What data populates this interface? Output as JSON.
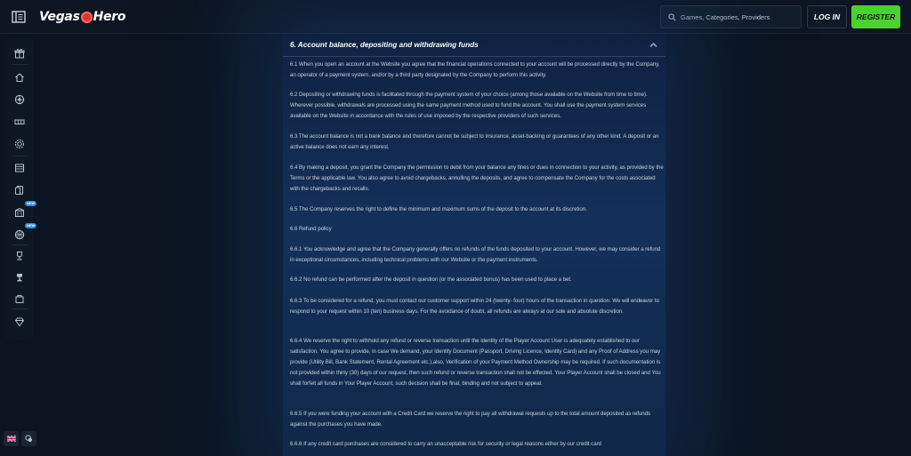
{
  "header": {
    "logo_part1": "Vegas",
    "logo_part2": "Hero",
    "search_placeholder": "Games, Categories, Providers",
    "login_label": "LOG IN",
    "register_label": "REGISTER",
    "colors": {
      "register_bg": "#4cd12f",
      "logo_chip": "#e0322c"
    }
  },
  "sidebar": {
    "items": [
      {
        "icon": "gift-icon"
      },
      {
        "icon": "home-icon"
      },
      {
        "icon": "roulette-icon"
      },
      {
        "icon": "slots-icon"
      },
      {
        "icon": "live-casino-icon"
      },
      {
        "icon": "table-games-icon"
      },
      {
        "icon": "cards-icon"
      },
      {
        "icon": "casino-building-icon",
        "badge": "NEW"
      },
      {
        "icon": "sports-ball-icon",
        "badge": "NEW"
      },
      {
        "icon": "trophy-icon"
      },
      {
        "icon": "tournament-cup-icon"
      },
      {
        "icon": "shop-icon"
      },
      {
        "icon": "diamond-icon"
      }
    ],
    "bottom": {
      "language_icon": "uk-flag-icon",
      "support_icon": "chat-icon"
    }
  },
  "section": {
    "title": "6.    Account balance, depositing and withdrawing funds",
    "paragraphs": [
      "6.1 When you open an account at the Website you agree that the financial operations connected to your account will be processed directly by the Company, an operator of a payment system, and/or by a third party designated by the Company to perform this activity.",
      "6.2 Depositing or withdrawing funds is facilitated through the payment system of your choice (among those available on the Website from time to time). Wherever possible, withdrawals are processed using the same payment method used to fund the account. You shall use the payment system services available on the Website in accordance with the rules of use imposed by the respective providers of such services.",
      "6.3 The account balance is not a bank balance and therefore cannot be subject to insurance, asset-backing or guarantees of any other kind. A deposit or an active balance does not earn any interest.",
      "6.4 By making a deposit, you grant the Company the permission to debit from your balance any fines or dues in connection to your activity, as provided by the Terms or the applicable law. You also agree to avoid chargebacks, annulling the deposits, and agree to compensate the Company for the costs associated with the chargebacks and recalls.",
      "6.5 The Company reserves the right to define the minimum and maximum sums of the deposit to the account at its discretion.",
      "6.6 Refund policy",
      "6.6.1 You acknowledge and agree that the Company generally offers no refunds of the funds deposited to your account. However, we may consider a refund in exceptional circumstances, including technical problems with our Website or the payment instruments.",
      "6.6.2 No refund can be performed after the deposit in question (or the associated bonus) has been used to place a bet.",
      "6.6.3 To be considered for a refund, you must contact our customer support within 24 (twenty- four) hours of the transaction in question. We will endeavor to respond to your request within 10 (ten) business days. For the avoidance of doubt, all refunds are always at our sole and absolute discretion.",
      "6.6.4 We reserve the right to withhold any refund or reverse transaction until the identity of the Player Account User is adequately established to our satisfaction. You agree to provide, in case We demand, your Identity Document (Passport, Driving Licence, Identity Card) and any Proof of Address you may provide (Utility Bill, Bank Statement, Rental Agreement etc.),also, Verification of your Payment Method Ownership may be required. If such documentation is not provided within thirty (30) days of our request, then such refund or reverse transaction shall not be effected. Your Player Account shall be closed and You shall forfeit all funds in Your Player Account, such decision shall be final, binding and not subject to appeal.",
      "6.6.5 If you were funding your account with a Credit Card we reserve the right to pay all withdrawal requests up to the total amount deposited as refunds against the purchases you have made.",
      "6.6.6 If any credit card purchases are considered to carry an unacceptable risk for security or legal reasons either by our credit card"
    ]
  }
}
